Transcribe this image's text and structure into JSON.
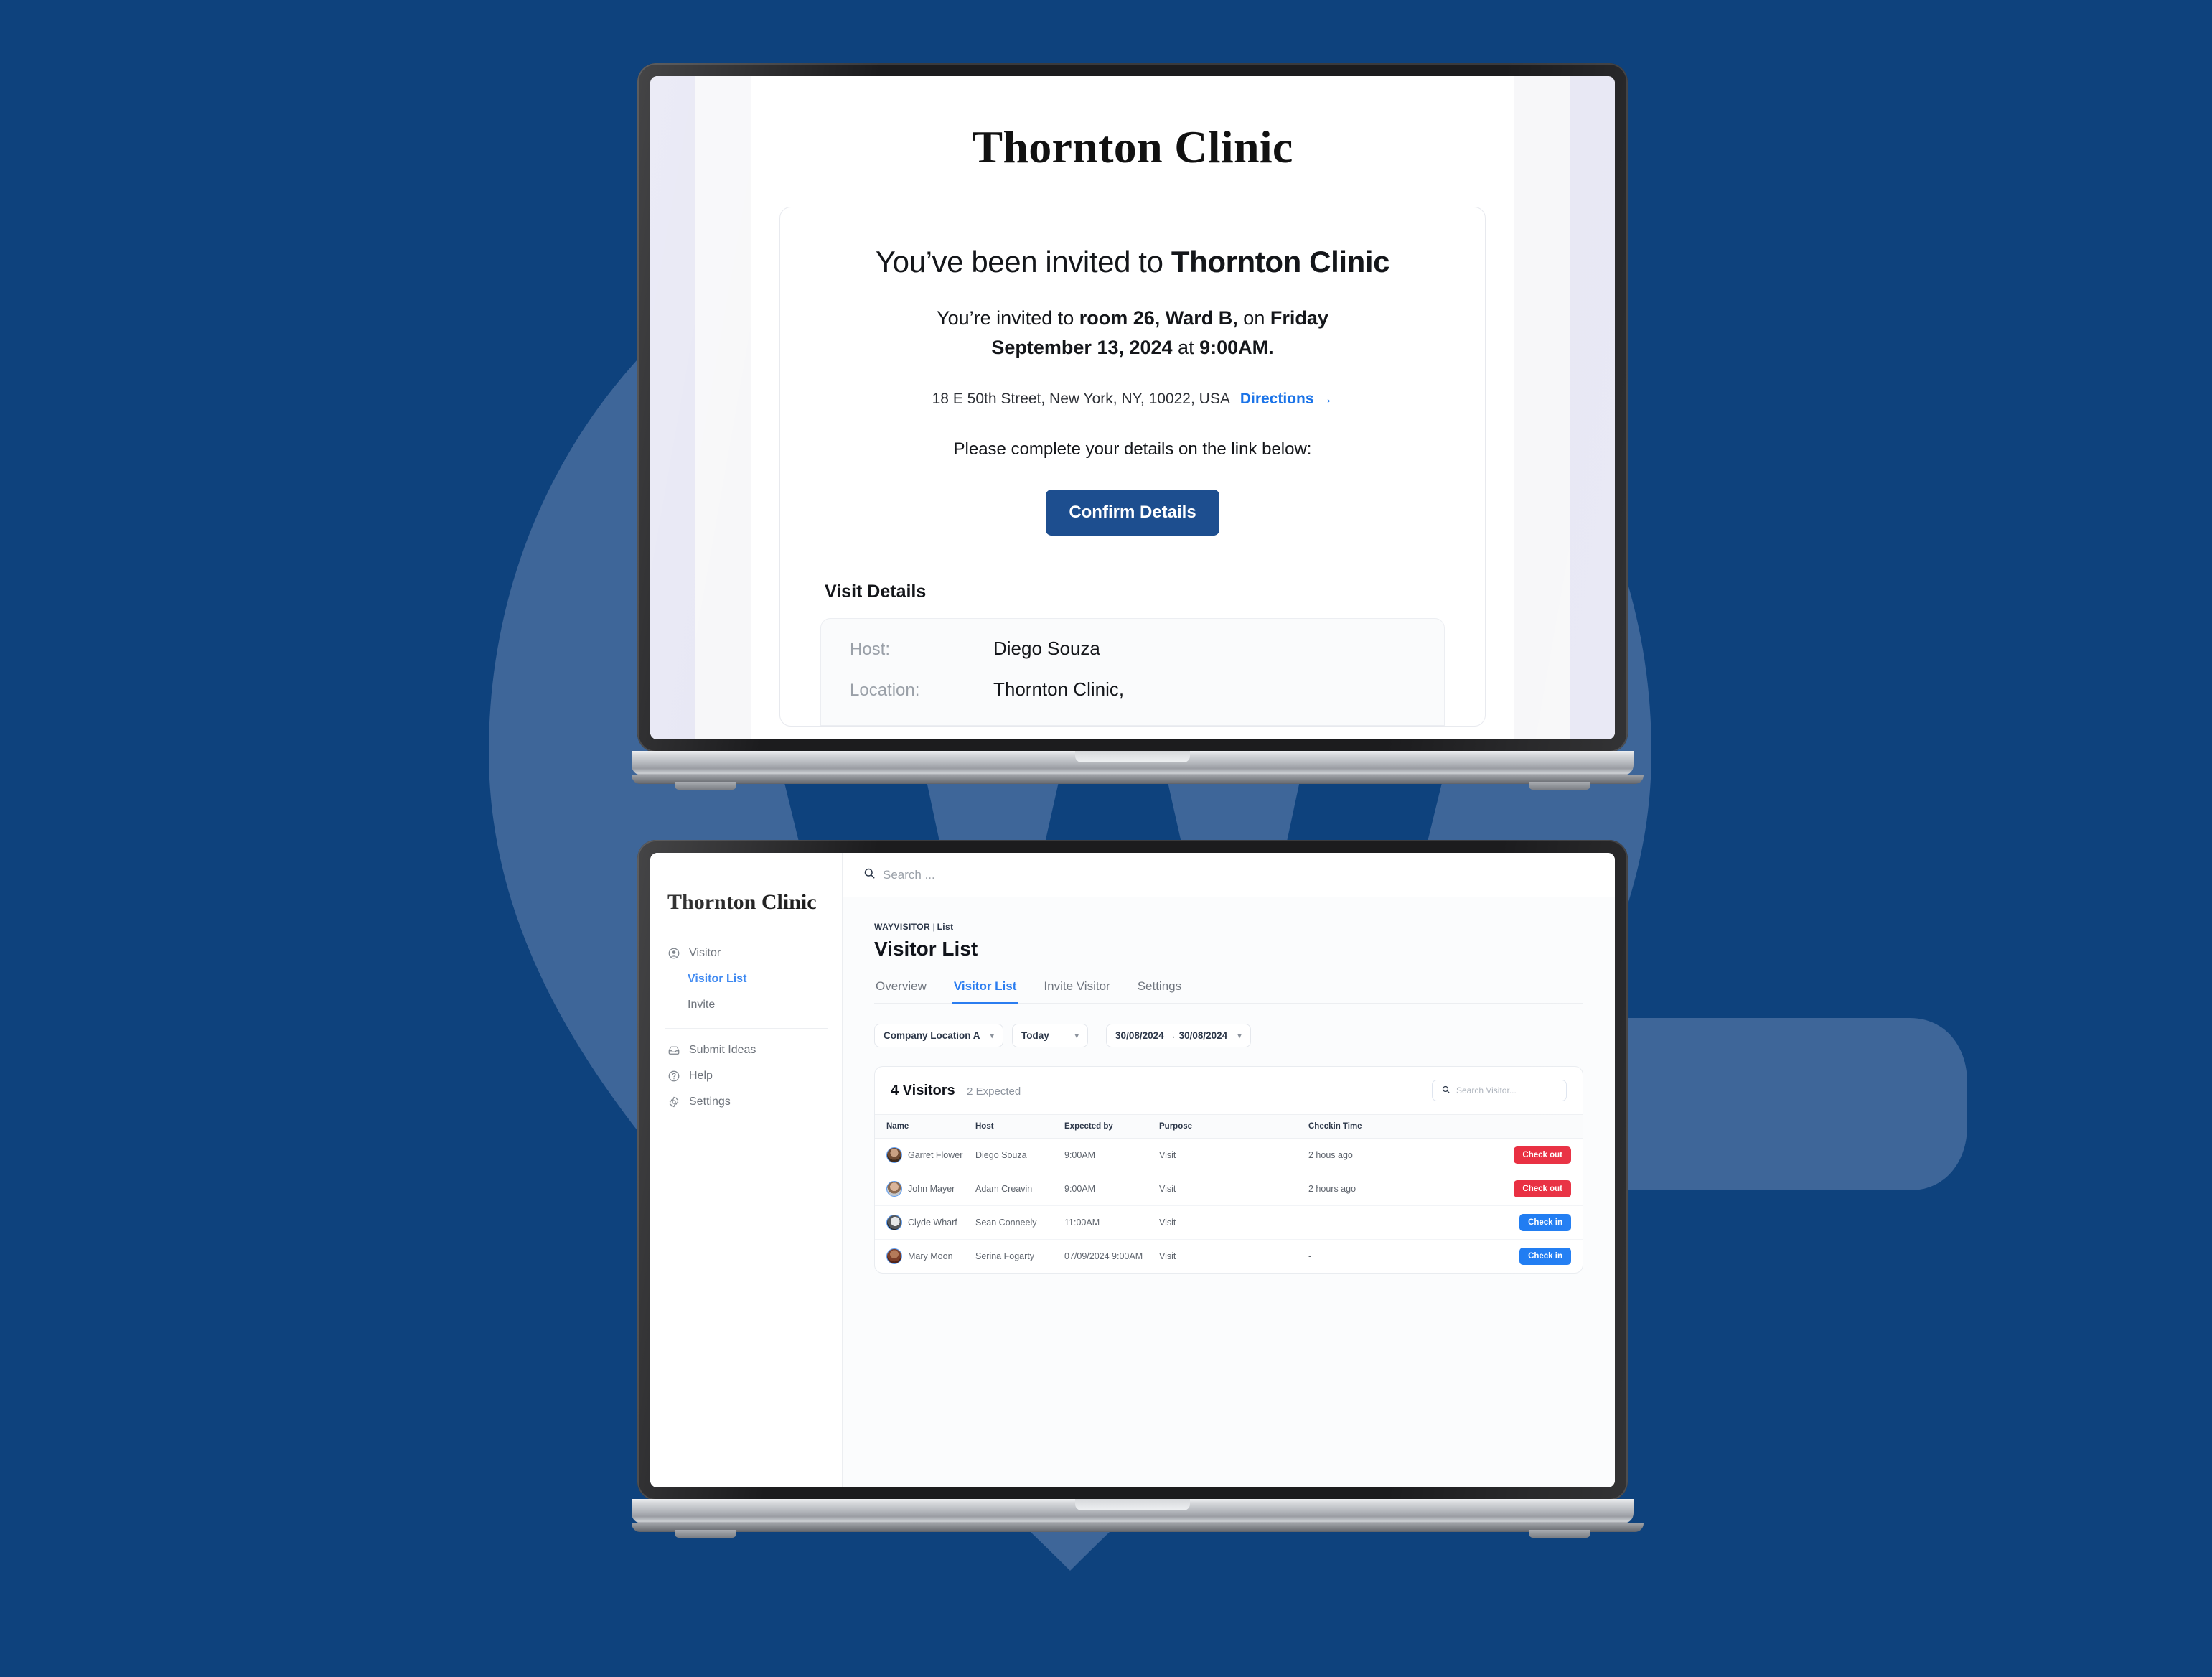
{
  "theme": {
    "page_bg": "#0e427d",
    "watermark": "#3e6699",
    "accent_blue": "#2b7df0",
    "brand_navy": "#1d4e8f",
    "danger_red": "#e8293c",
    "check_in_blue": "#1878f2"
  },
  "email": {
    "brand_title": "Thornton Clinic",
    "headline_prefix": "You’ve been invited to ",
    "headline_org": "Thornton Clinic",
    "invite_line_1_a": "You’re invited to ",
    "invite_line_1_room": "room 26, Ward B,",
    "invite_line_1_b": " on ",
    "invite_line_1_day": "Friday",
    "invite_line_2_date": "September 13, 2024",
    "invite_line_2_mid": " at ",
    "invite_line_2_time": "9:00AM.",
    "address": "18 E 50th Street, New York, NY, 10022, USA",
    "directions_label": "Directions →",
    "complete_line": "Please complete your details on the link below:",
    "confirm_button": "Confirm Details",
    "visit_details_title": "Visit Details",
    "visit_details": [
      {
        "key": "Host:",
        "value": "Diego Souza"
      },
      {
        "key": "Location:",
        "value": "Thornton Clinic,"
      }
    ]
  },
  "dashboard": {
    "sidebar": {
      "brand": "Thornton Clinic",
      "items": [
        {
          "label": "Visitor",
          "icon": "user-circle-icon",
          "type": "group"
        },
        {
          "label": "Visitor List",
          "icon": "",
          "type": "sub",
          "active": true
        },
        {
          "label": "Invite",
          "icon": "",
          "type": "sub",
          "active": false
        }
      ],
      "footer_items": [
        {
          "label": "Submit Ideas",
          "icon": "inbox-icon"
        },
        {
          "label": "Help",
          "icon": "question-circle-icon"
        },
        {
          "label": "Settings",
          "icon": "gear-icon"
        }
      ]
    },
    "topbar": {
      "search_placeholder": "Search ...",
      "search_icon": "search-icon"
    },
    "breadcrumb_root": "WAYVISITOR",
    "breadcrumb_sep": "|",
    "breadcrumb_leaf": "List",
    "page_title": "Visitor List",
    "tabs": [
      {
        "label": "Overview",
        "active": false
      },
      {
        "label": "Visitor List",
        "active": true
      },
      {
        "label": "Invite Visitor",
        "active": false
      },
      {
        "label": "Settings",
        "active": false
      }
    ],
    "filters": [
      {
        "label": "Company Location A",
        "chevron": "chevron-down-icon"
      },
      {
        "label": "Today",
        "chevron": "chevron-down-icon"
      },
      {
        "label": "30/08/2024 → 30/08/2024",
        "chevron": "chevron-down-icon"
      }
    ],
    "panel": {
      "count_label": "4 Visitors",
      "expected_label": "2 Expected",
      "search_placeholder": "Search Visitor...",
      "search_icon": "search-icon",
      "columns": [
        "Name",
        "Host",
        "Expected by",
        "Purpose",
        "Checkin Time",
        ""
      ],
      "rows": [
        {
          "name": "Garret Flower",
          "host": "Diego Souza",
          "expected_by": "9:00AM",
          "purpose": "Visit",
          "checkin_time": "2 hous ago",
          "action": "Check out",
          "action_kind": "out",
          "avatar_colors": [
            "#c9a083",
            "#6f4a33",
            "#3d2a1c"
          ]
        },
        {
          "name": "John Mayer",
          "host": "Adam Creavin",
          "expected_by": "9:00AM",
          "purpose": "Visit",
          "checkin_time": "2 hours ago",
          "action": "Check out",
          "action_kind": "out",
          "avatar_colors": [
            "#d9b49a",
            "#8a6a52",
            "#c2c6cb"
          ]
        },
        {
          "name": "Clyde Wharf",
          "host": "Sean Conneely",
          "expected_by": "11:00AM",
          "purpose": "Visit",
          "checkin_time": "-",
          "action": "Check in",
          "action_kind": "in",
          "avatar_colors": [
            "#e6e8ea",
            "#55585c",
            "#1f2124"
          ]
        },
        {
          "name": "Mary Moon",
          "host": "Serina Fogarty",
          "expected_by": "07/09/2024 9:00AM",
          "purpose": "Visit",
          "checkin_time": "-",
          "action": "Check in",
          "action_kind": "in",
          "avatar_colors": [
            "#b47a5a",
            "#7c3f2a",
            "#512419"
          ]
        }
      ]
    }
  }
}
